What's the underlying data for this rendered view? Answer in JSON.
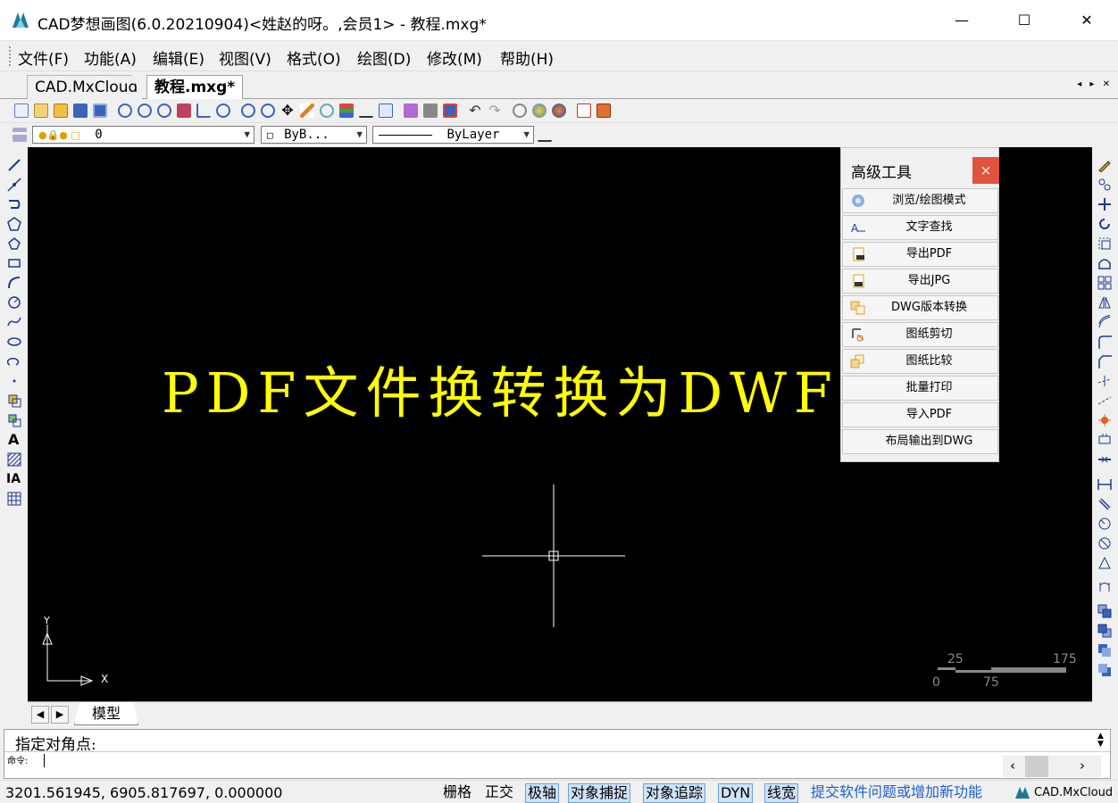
{
  "window": {
    "title": "CAD梦想画图(6.0.20210904)<姓赵的呀。,会员1> - 教程.mxg*",
    "minimize": "—",
    "maximize": "☐",
    "close": "✕"
  },
  "menu": [
    "文件(F)",
    "功能(A)",
    "编辑(E)",
    "视图(V)",
    "格式(O)",
    "绘图(D)",
    "修改(M)",
    "帮助(H)"
  ],
  "doc_tabs": {
    "cloud": "CAD.MxCloud",
    "active": "教程.mxg*",
    "nav": "◂ ▸ ✕"
  },
  "layer_bar": {
    "layer_value": "0",
    "color_value": "ByB...",
    "linetype_value": "ByLayer"
  },
  "drawing": {
    "text": "PDF文件换转换为DWF文",
    "axis_y": "Y",
    "axis_x": "X",
    "scale_labels": {
      "top_left": "25",
      "top_right": "175",
      "bottom_left": "0",
      "bottom_mid": "75"
    }
  },
  "panel": {
    "title": "高级工具",
    "close": "×",
    "buttons": [
      "浏览/绘图模式",
      "文字查找",
      "导出PDF",
      "导出JPG",
      "DWG版本转换",
      "图纸剪切",
      "图纸比较",
      "批量打印",
      "导入PDF",
      "布局输出到DWG"
    ]
  },
  "model_tab": {
    "label": "模型"
  },
  "command": {
    "history": "指定对角点:",
    "prompt": "命令:"
  },
  "status": {
    "coords": "3201.561945,  6905.817697,  0.000000",
    "grid": "栅格",
    "ortho": "正交",
    "polar": "极轴",
    "osnap": "对象捕捉",
    "otrack": "对象追踪",
    "dyn": "DYN",
    "lwt": "线宽",
    "feedback": "提交软件问题或增加新功能",
    "brand": "CAD.MxCloud"
  },
  "colors": {
    "canvas": "#000000",
    "drawing_text": "#ffff00",
    "panel_close": "#e0533f",
    "status_on": "#cfe3f8",
    "link": "#1a5fd0"
  }
}
